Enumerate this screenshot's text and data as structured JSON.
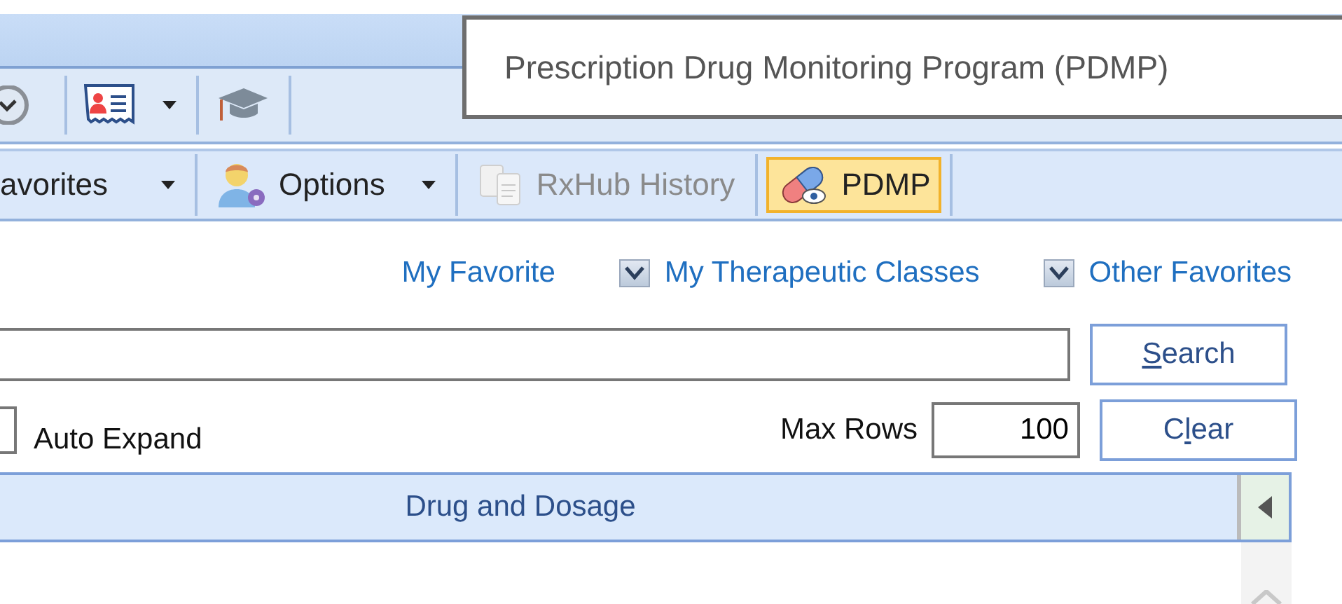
{
  "title_box": {
    "title": "Prescription Drug Monitoring Program (PDMP)"
  },
  "toolbar_top": [
    {
      "kind": "clock",
      "dropdown": false
    },
    {
      "kind": "card",
      "dropdown": true
    },
    {
      "kind": "cap",
      "dropdown": false
    }
  ],
  "toolbar": [
    {
      "label": "avorites",
      "kind": "none",
      "dropdown": true,
      "disabled": false,
      "selected": false
    },
    {
      "label": "Options",
      "kind": "user",
      "dropdown": true,
      "disabled": false,
      "selected": false
    },
    {
      "label": "RxHub History",
      "kind": "bottles",
      "dropdown": false,
      "disabled": true,
      "selected": false
    },
    {
      "label": "PDMP",
      "kind": "pill",
      "dropdown": false,
      "disabled": false,
      "selected": true
    }
  ],
  "favorites": [
    {
      "label": "My Favorite",
      "kind": "link"
    },
    {
      "label": "My Therapeutic Classes",
      "kind": "checkbox",
      "checked": true
    },
    {
      "label": "Other Favorites",
      "kind": "checkbox",
      "checked": true
    }
  ],
  "search": {
    "mnemonic": "S",
    "after": "earch"
  },
  "auto_expand": {
    "label": "Auto Expand",
    "checked": false
  },
  "max_rows": {
    "label": "Max Rows",
    "value": "100"
  },
  "clear": {
    "before": "C",
    "mnemonic": "l",
    "after": "ear"
  },
  "table": {
    "columns": [
      "Drug and Dosage"
    ]
  }
}
